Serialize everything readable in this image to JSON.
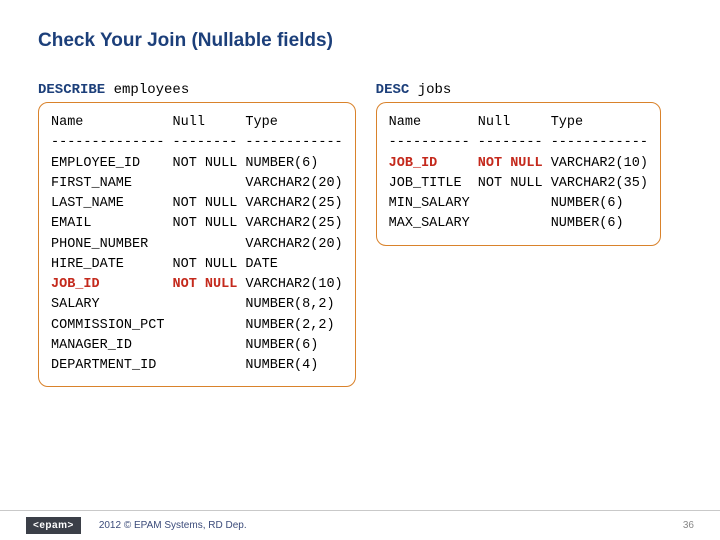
{
  "title": "Check Your Join (Nullable fields)",
  "left": {
    "keyword": "DESCRIBE",
    "target": "employees",
    "header": "Name           Null     Type",
    "divider": "-------------- -------- ------------",
    "rows": [
      "EMPLOYEE_ID    NOT NULL NUMBER(6)",
      "FIRST_NAME              VARCHAR2(20)",
      "LAST_NAME      NOT NULL VARCHAR2(25)",
      "EMAIL          NOT NULL VARCHAR2(25)",
      "PHONE_NUMBER            VARCHAR2(20)",
      "HIRE_DATE      NOT NULL DATE"
    ],
    "hl_name": "JOB_ID         ",
    "hl_null": "NOT NULL",
    "hl_type": " VARCHAR2(10)",
    "rows2": [
      "SALARY                  NUMBER(8,2)",
      "COMMISSION_PCT          NUMBER(2,2)",
      "MANAGER_ID              NUMBER(6)",
      "DEPARTMENT_ID           NUMBER(4)"
    ]
  },
  "right": {
    "keyword": "DESC",
    "target": "jobs",
    "header": "Name       Null     Type",
    "divider": "---------- -------- ------------",
    "hl_name": "JOB_ID     ",
    "hl_null": "NOT NULL",
    "hl_type": " VARCHAR2(10)",
    "rows": [
      "JOB_TITLE  NOT NULL VARCHAR2(35)",
      "MIN_SALARY          NUMBER(6)",
      "MAX_SALARY          NUMBER(6)"
    ]
  },
  "footer": {
    "badge": "<epam>",
    "copyright": "2012 © EPAM Systems, RD Dep.",
    "page": "36"
  }
}
